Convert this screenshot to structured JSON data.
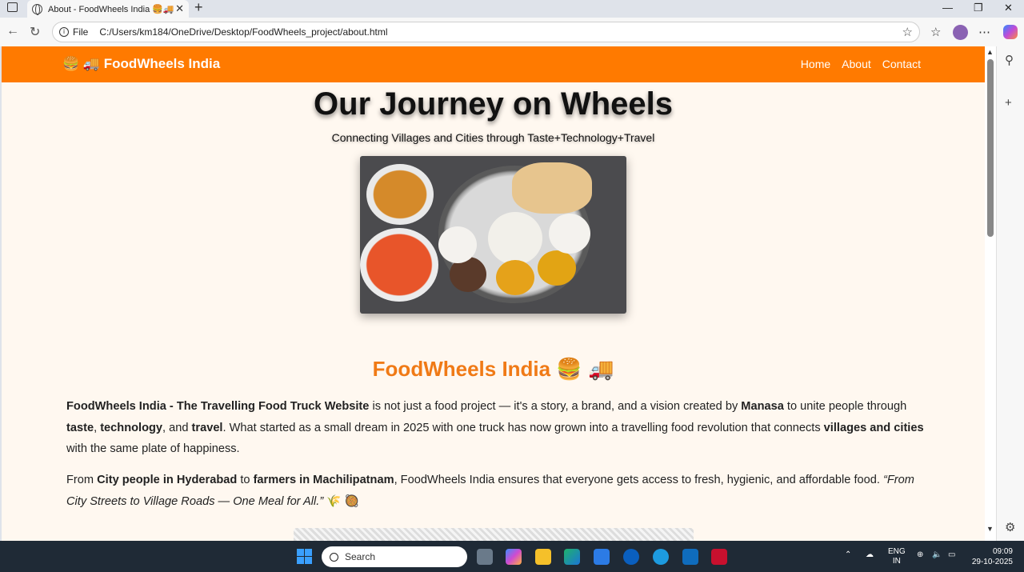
{
  "browser": {
    "tab_title": "About - FoodWheels India 🍔🚚",
    "close_glyph": "✕",
    "newtab_glyph": "+",
    "file_label": "File",
    "url": "C:/Users/km184/OneDrive/Desktop/FoodWheels_project/about.html"
  },
  "nav": {
    "brand": "🍔 🚚 FoodWheels India",
    "links": [
      "Home",
      "About",
      "Contact"
    ]
  },
  "hero": {
    "title": "Our Journey on Wheels",
    "subtitle": "Connecting Villages and Cities through Taste+Technology+Travel"
  },
  "section": {
    "heading": "FoodWheels India 🍔 🚚"
  },
  "paragraph1": {
    "b1": "FoodWheels India - The Travelling Food Truck Website",
    "t1": " is not just a food project — it's a story, a brand, and a vision created by ",
    "b2": "Manasa",
    "t2": " to unite people through ",
    "b3": "taste",
    "t3": ", ",
    "b4": "technology",
    "t4": ", and ",
    "b5": "travel",
    "t5": ". What started as a small dream in 2025 with one truck has now grown into a travelling food revolution that connects ",
    "b6": "villages and cities",
    "t6": " with the same plate of happiness."
  },
  "paragraph2": {
    "t1": "From ",
    "b1": "City people in Hyderabad",
    "t2": " to ",
    "b2": "farmers in Machilipatnam",
    "t3": ", FoodWheels India ensures that everyone gets access to fresh, hygienic, and affordable food. ",
    "i1": "“From City Streets to Village Roads — One Meal for All.”",
    "t4": " 🌾 🥘"
  },
  "taskbar": {
    "search_placeholder": "Search",
    "lang_top": "ENG",
    "lang_bottom": "IN",
    "time": "09:09",
    "date": "29-10-2025"
  },
  "colors": {
    "nav_bg": "#ff7a00",
    "heading": "#f07a16",
    "page_bg": "#fff8f0"
  }
}
